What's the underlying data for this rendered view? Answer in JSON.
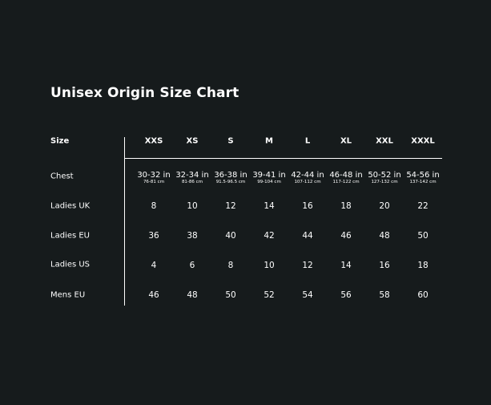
{
  "title": "Unisex Origin Size Chart",
  "header_label": "Size",
  "sizes": [
    "XXS",
    "XS",
    "S",
    "M",
    "L",
    "XL",
    "XXL",
    "XXXL"
  ],
  "chest": {
    "label": "Chest",
    "inches": [
      "30-32 in",
      "32-34 in",
      "36-38 in",
      "39-41 in",
      "42-44 in",
      "46-48 in",
      "50-52 in",
      "54-56 in"
    ],
    "cm": [
      "76-81 cm",
      "81-86 cm",
      "91.5-96.5 cm",
      "99-104 cm",
      "107-112 cm",
      "117-122 cm",
      "127-132 cm",
      "137-142 cm"
    ]
  },
  "rows": [
    {
      "label": "Ladies UK",
      "values": [
        "8",
        "10",
        "12",
        "14",
        "16",
        "18",
        "20",
        "22"
      ]
    },
    {
      "label": "Ladies EU",
      "values": [
        "36",
        "38",
        "40",
        "42",
        "44",
        "46",
        "48",
        "50"
      ]
    },
    {
      "label": "Ladies US",
      "values": [
        "4",
        "6",
        "8",
        "10",
        "12",
        "14",
        "16",
        "18"
      ]
    },
    {
      "label": "Mens EU",
      "values": [
        "46",
        "48",
        "50",
        "52",
        "54",
        "56",
        "58",
        "60"
      ]
    }
  ],
  "colors": {
    "background": "#161b1c",
    "text": "#ffffff",
    "rule": "#ffffff"
  }
}
